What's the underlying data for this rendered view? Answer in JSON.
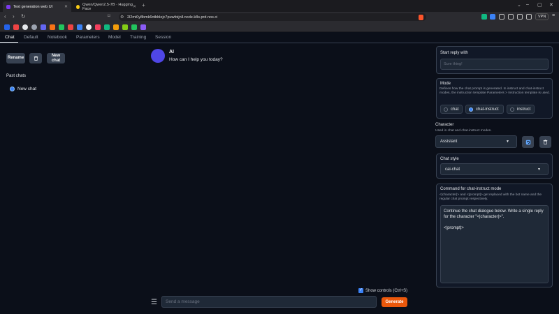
{
  "browser": {
    "tabs": [
      {
        "title": "Text generation web UI",
        "active": true
      },
      {
        "title": "Qwen/Qwen2.5-7B · Hugging Face",
        "active": false
      }
    ],
    "url": "2l2mi0y8bmk6ntbblejc7puwfoijnll.node.k8s.prd.nos.ci",
    "vpn_label": "VPN"
  },
  "app_tabs": [
    "Chat",
    "Default",
    "Notebook",
    "Parameters",
    "Model",
    "Training",
    "Session"
  ],
  "left": {
    "rename": "Rename",
    "new_chat_line1": "New",
    "new_chat_line2": "chat",
    "past_chats": "Past chats",
    "chat_item": "New chat"
  },
  "chat": {
    "name": "AI",
    "message": "How can I help you today?"
  },
  "input": {
    "show_controls": "Show controls (Ctrl+S)",
    "placeholder": "Send a message",
    "generate": "Generate"
  },
  "right": {
    "start_reply": {
      "title": "Start reply with",
      "placeholder": "Sure thing!"
    },
    "mode": {
      "title": "Mode",
      "desc": "Defines how the chat prompt is generated. In instruct and chat-instruct modes, the instruction template Parameters > Instruction template is used.",
      "options": [
        "chat",
        "chat-instruct",
        "instruct"
      ],
      "selected": "chat-instruct"
    },
    "character": {
      "title": "Character",
      "desc": "Used in chat and chat-instruct modes.",
      "value": "Assistant"
    },
    "chat_style": {
      "title": "Chat style",
      "value": "cai-chat"
    },
    "command": {
      "title": "Command for chat-instruct mode",
      "desc": "<|character|> and <|prompt|> get replaced with the bot name and the regular chat prompt respectively.",
      "value": "Continue the chat dialogue below. Write a single reply for the character \"<|character|>\".\n\n<|prompt|>"
    }
  },
  "colors": {
    "accent": "#3b82f6",
    "generate": "#ea580c",
    "avatar": "#4f46e5"
  }
}
